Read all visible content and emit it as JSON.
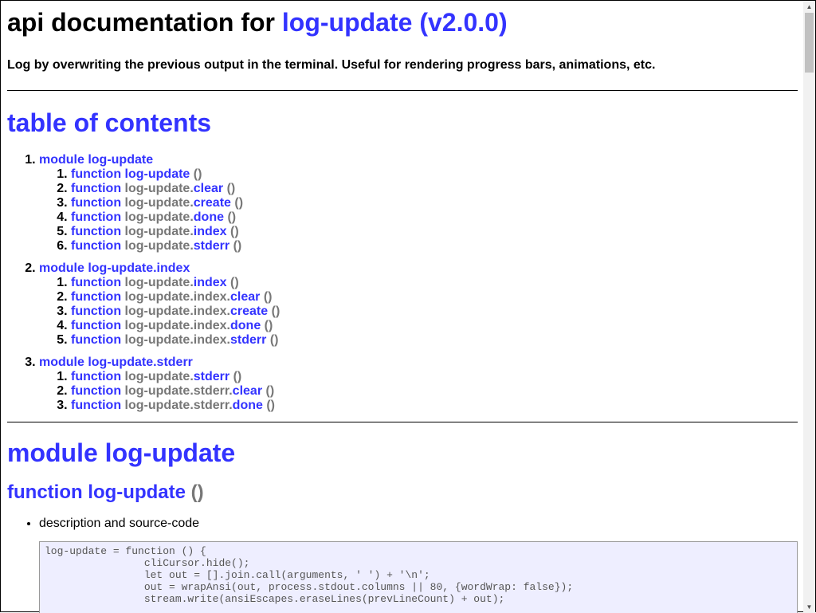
{
  "header": {
    "title_prefix": "api documentation for",
    "title_link": "log-update (v2.0.0)",
    "description": "Log by overwriting the previous output in the terminal. Useful for rendering progress bars, animations, etc."
  },
  "toc": {
    "heading": "table of contents",
    "parens": "()",
    "modules": [
      {
        "label": "module log-update",
        "functions": [
          {
            "kw": "function",
            "prefix": "",
            "name": "log-update"
          },
          {
            "kw": "function",
            "prefix": "log-update.",
            "name": "clear"
          },
          {
            "kw": "function",
            "prefix": "log-update.",
            "name": "create"
          },
          {
            "kw": "function",
            "prefix": "log-update.",
            "name": "done"
          },
          {
            "kw": "function",
            "prefix": "log-update.",
            "name": "index"
          },
          {
            "kw": "function",
            "prefix": "log-update.",
            "name": "stderr"
          }
        ]
      },
      {
        "label": "module log-update.index",
        "functions": [
          {
            "kw": "function",
            "prefix": "log-update.",
            "name": "index"
          },
          {
            "kw": "function",
            "prefix": "log-update.index.",
            "name": "clear"
          },
          {
            "kw": "function",
            "prefix": "log-update.index.",
            "name": "create"
          },
          {
            "kw": "function",
            "prefix": "log-update.index.",
            "name": "done"
          },
          {
            "kw": "function",
            "prefix": "log-update.index.",
            "name": "stderr"
          }
        ]
      },
      {
        "label": "module log-update.stderr",
        "functions": [
          {
            "kw": "function",
            "prefix": "log-update.",
            "name": "stderr"
          },
          {
            "kw": "function",
            "prefix": "log-update.stderr.",
            "name": "clear"
          },
          {
            "kw": "function",
            "prefix": "log-update.stderr.",
            "name": "done"
          }
        ]
      }
    ]
  },
  "section": {
    "module_title": "module log-update",
    "function_title": "function log-update",
    "function_parens": "()",
    "desc_item": "description and source-code",
    "code": "log-update = function () {\n\t\tcliCursor.hide();\n\t\tlet out = [].join.call(arguments, ' ') + '\\n';\n\t\tout = wrapAnsi(out, process.stdout.columns || 80, {wordWrap: false});\n\t\tstream.write(ansiEscapes.eraseLines(prevLineCount) + out);"
  },
  "scrollbar": {
    "up_icon": "triangle-up-icon",
    "down_icon": "triangle-down-icon"
  }
}
